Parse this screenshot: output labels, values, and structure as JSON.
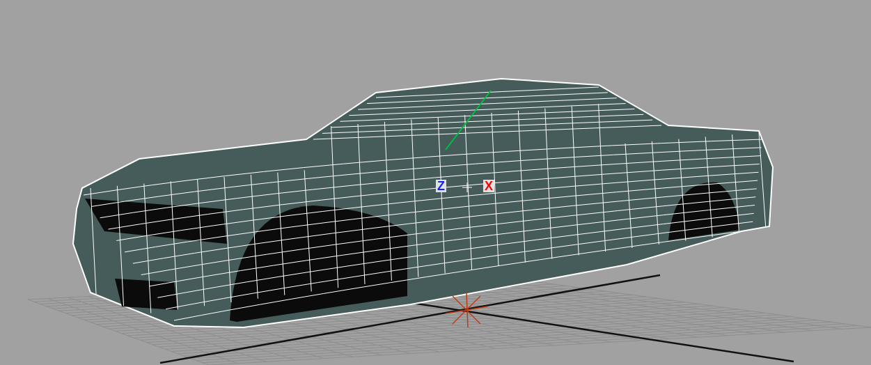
{
  "viewport": {
    "axis_labels": [
      {
        "text": "Z",
        "color": "#1a1aff"
      },
      {
        "text": "X",
        "color": "#ff0000"
      }
    ]
  }
}
